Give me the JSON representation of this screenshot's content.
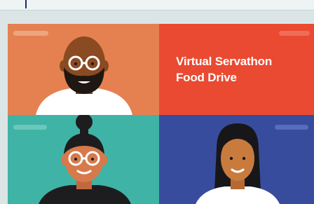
{
  "event": {
    "title_line1": "Virtual Servathon",
    "title_line2": "Food Drive"
  },
  "colors": {
    "tile_orange": "#e58150",
    "tile_red": "#ea4a31",
    "tile_teal": "#3fb3a6",
    "tile_blue": "#384c9e"
  },
  "participants": [
    {
      "icon": "bald-man-glasses-beard-avatar"
    },
    {
      "icon": "man-topknot-glasses-avatar"
    },
    {
      "icon": "woman-long-hair-avatar"
    }
  ]
}
